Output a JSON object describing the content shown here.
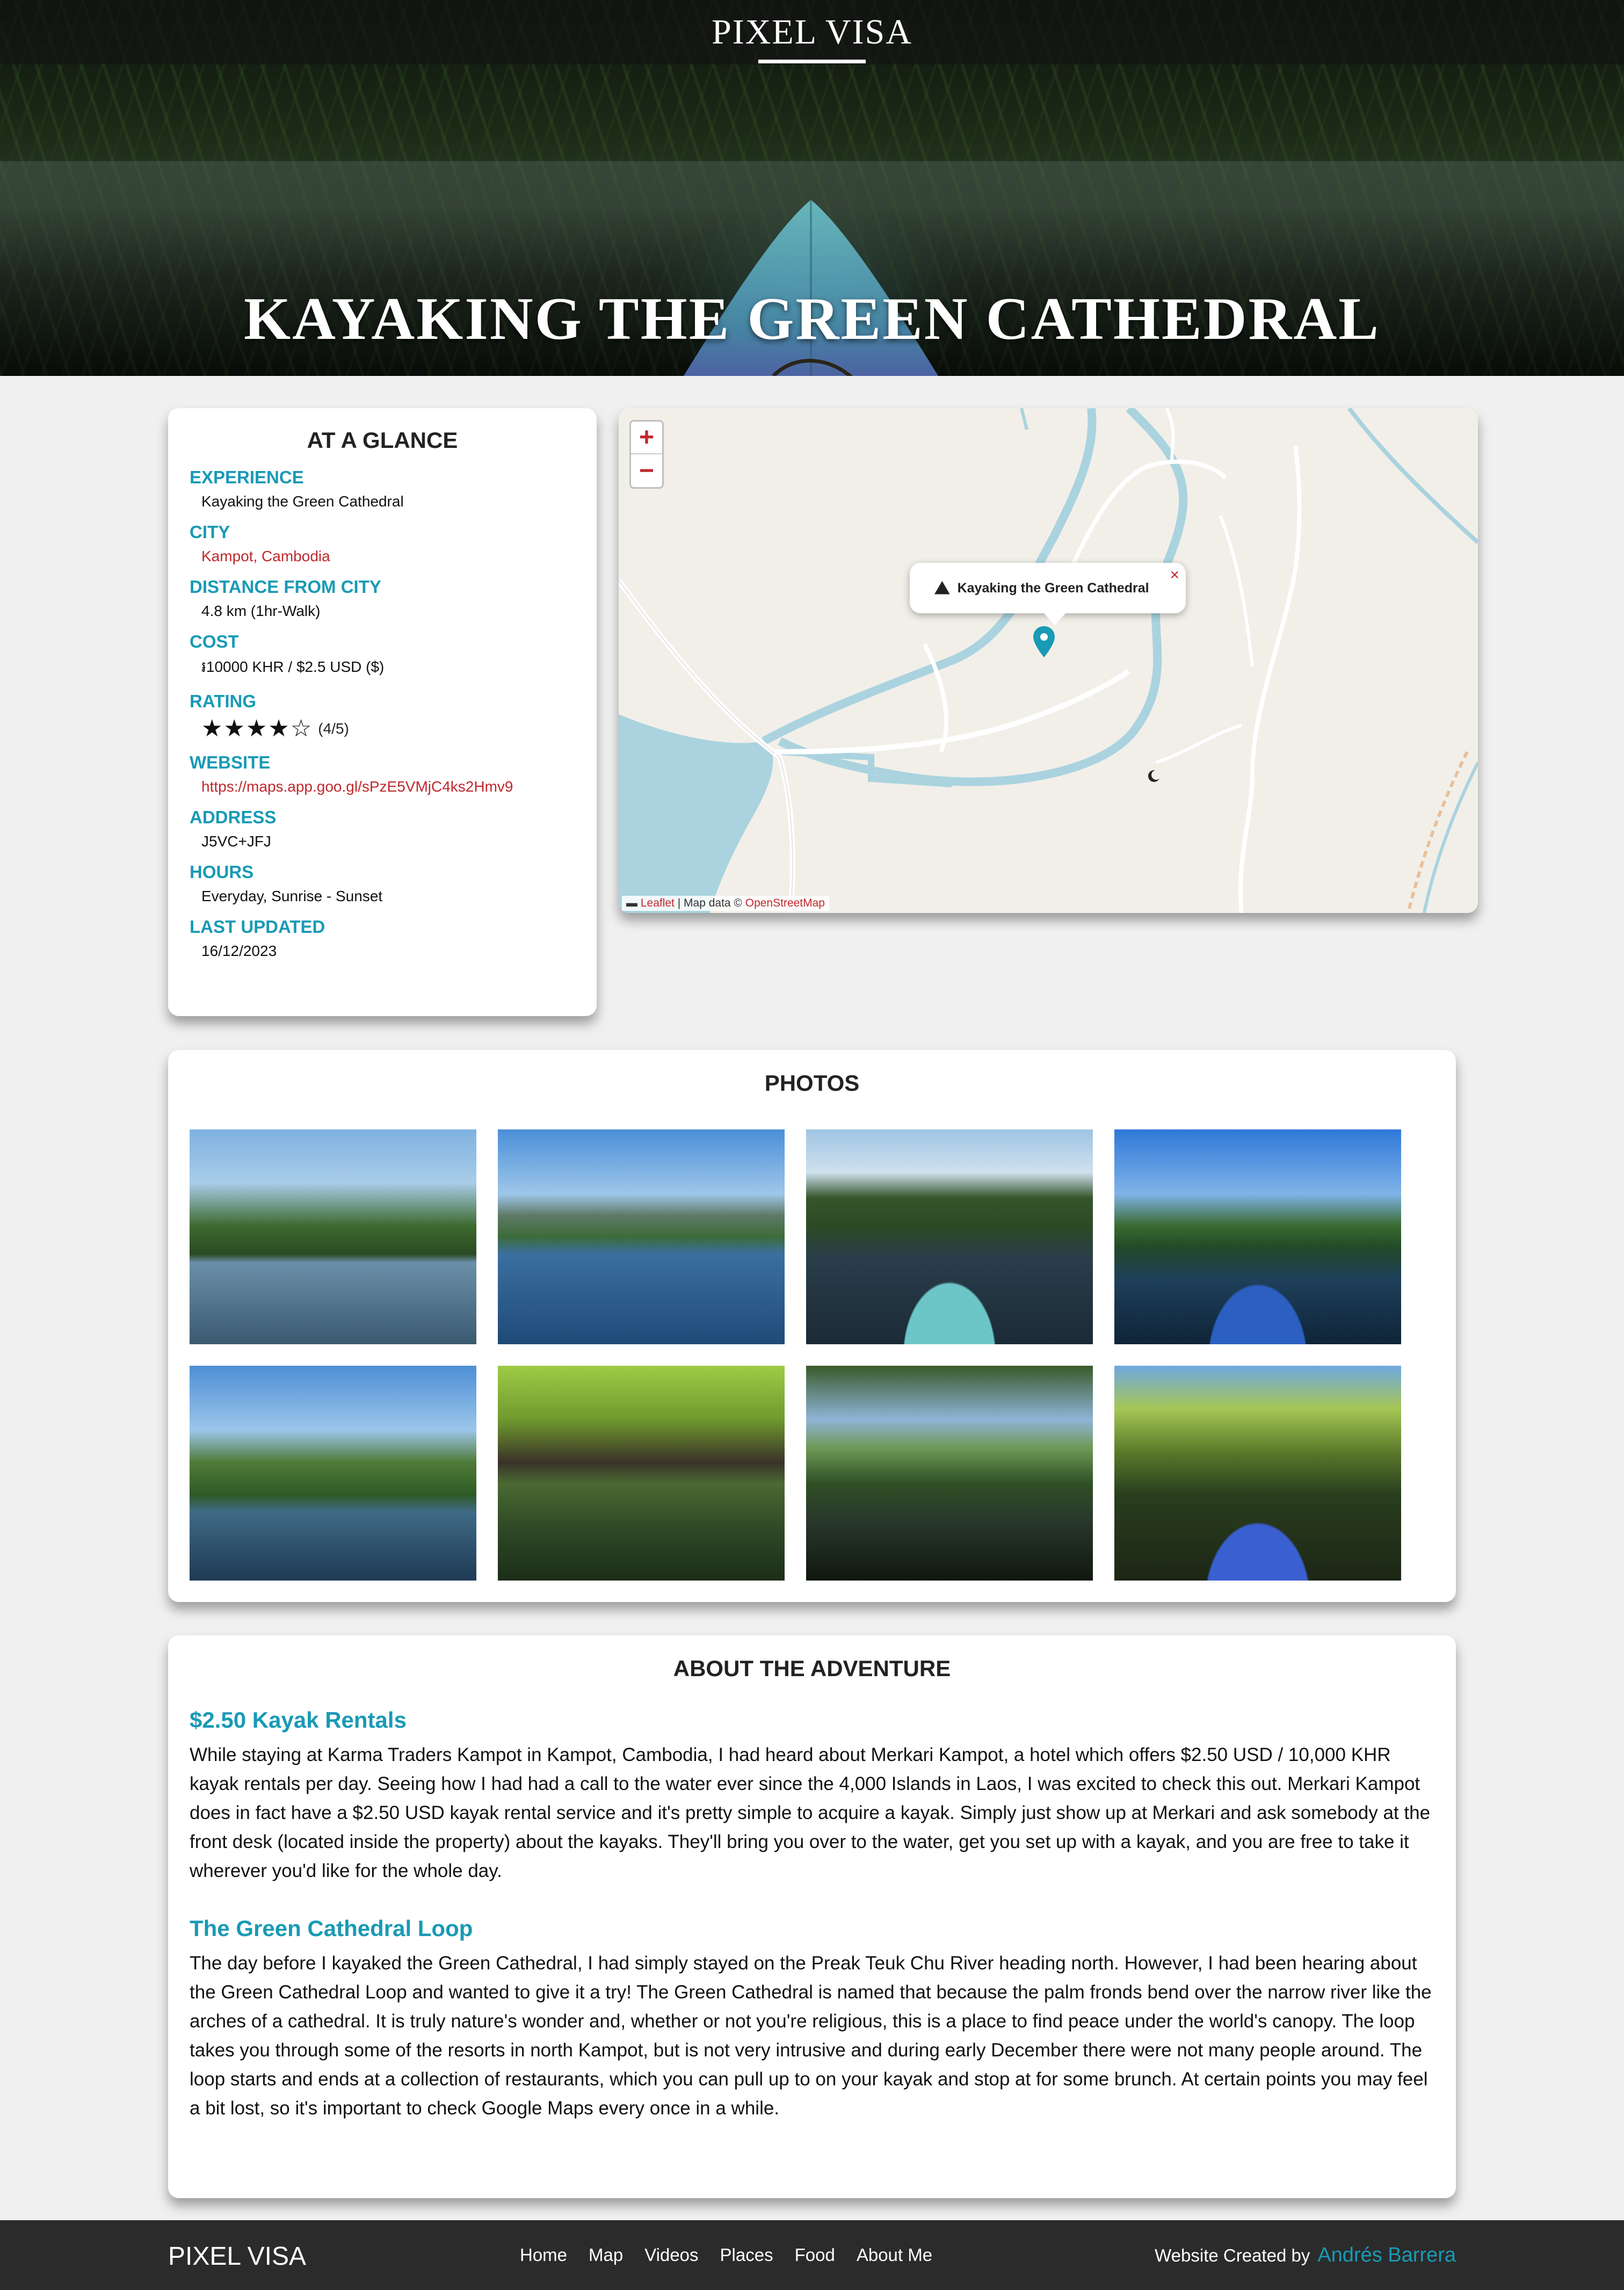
{
  "header": {
    "brand": "PIXEL VISA",
    "title": "KAYAKING THE GREEN CATHEDRAL"
  },
  "glance": {
    "heading": "AT A GLANCE",
    "fields": [
      {
        "label": "EXPERIENCE",
        "value": "Kayaking the Green Cathedral"
      },
      {
        "label": "CITY",
        "value": "Kampot, Cambodia"
      },
      {
        "label": "DISTANCE FROM CITY",
        "value": "4.8 km (1hr-Walk)"
      },
      {
        "label": "COST",
        "value": "៛10000 KHR / $2.5 USD ($)"
      },
      {
        "label": "RATING",
        "value": "(4/5)",
        "rating": 4,
        "max": 5
      },
      {
        "label": "WEBSITE",
        "value": "https://maps.app.goo.gl/sPzE5VMjC4ks2Hmv9"
      },
      {
        "label": "ADDRESS",
        "value": "J5VC+JFJ"
      },
      {
        "label": "HOURS",
        "value": "Everyday, Sunrise - Sunset"
      },
      {
        "label": "LAST UPDATED",
        "value": "16/12/2023"
      }
    ]
  },
  "map": {
    "zoom_in": "+",
    "zoom_out": "−",
    "popup_title": "Kayaking the Green Cathedral",
    "popup_close": "×",
    "attribution": {
      "leaflet": "Leaflet",
      "sep": " | Map data © ",
      "osm": "OpenStreetMap"
    },
    "colors": {
      "water": "#aad3df",
      "land": "#f2efe9",
      "pin": "#199ab5"
    }
  },
  "photos": {
    "heading": "PHOTOS",
    "items": [
      "river-bridge",
      "river-hut-mountains",
      "kayak-bow-still-water",
      "kayak-palms",
      "sunken-boat-palm",
      "wooden-bridge",
      "river-jungle",
      "kayak-paddle"
    ]
  },
  "about": {
    "heading": "ABOUT THE ADVENTURE",
    "sections": [
      {
        "title": "$2.50 Kayak Rentals",
        "body": "While staying at Karma Traders Kampot in Kampot, Cambodia, I had heard about Merkari Kampot, a hotel which offers $2.50 USD / 10,000 KHR kayak rentals per day. Seeing how I had had a call to the water ever since the 4,000 Islands in Laos, I was excited to check this out. Merkari Kampot does in fact have a $2.50 USD kayak rental service and it's pretty simple to acquire a kayak. Simply just show up at Merkari and ask somebody at the front desk (located inside the property) about the kayaks. They'll bring you over to the water, get you set up with a kayak, and you are free to take it wherever you'd like for the whole day."
      },
      {
        "title": "The Green Cathedral Loop",
        "body": "The day before I kayaked the Green Cathedral, I had simply stayed on the Preak Teuk Chu River heading north. However, I had been hearing about the Green Cathedral Loop and wanted to give it a try! The Green Cathedral is named that because the palm fronds bend over the narrow river like the arches of a cathedral. It is truly nature's wonder and, whether or not you're religious, this is a place to find peace under the world's canopy. The loop takes you through some of the resorts in north Kampot, but is not very intrusive and during early December there were not many people around. The loop starts and ends at a collection of restaurants, which you can pull up to on your kayak and stop at for some brunch. At certain points you may feel a bit lost, so it's important to check Google Maps every once in a while."
      }
    ]
  },
  "footer": {
    "brand": "PIXEL VISA",
    "nav": [
      "Home",
      "Map",
      "Videos",
      "Places",
      "Food",
      "About Me"
    ],
    "credit": "Website Created by",
    "author": "Andrés Barrera"
  }
}
